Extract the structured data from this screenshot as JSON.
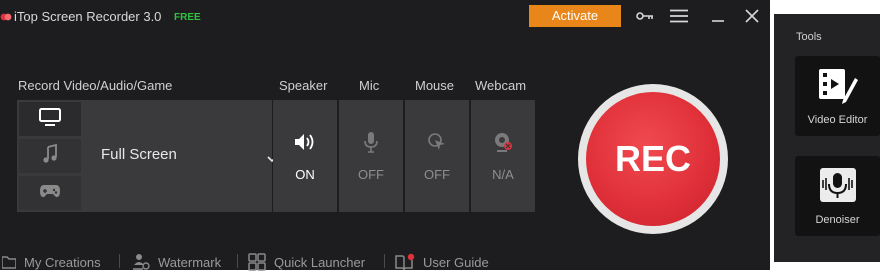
{
  "app": {
    "title": "iTop Screen Recorder 3.0",
    "badge": "FREE",
    "activate_label": "Activate"
  },
  "record": {
    "section_label": "Record Video/Audio/Game",
    "modes": [
      {
        "name": "screen",
        "icon": "monitor-icon"
      },
      {
        "name": "audio",
        "icon": "music-note-icon"
      },
      {
        "name": "game",
        "icon": "gamepad-icon"
      }
    ],
    "selected_area": "Full Screen"
  },
  "devices": [
    {
      "label": "Speaker",
      "state": "ON",
      "icon": "speaker-icon"
    },
    {
      "label": "Mic",
      "state": "OFF",
      "icon": "microphone-icon"
    },
    {
      "label": "Mouse",
      "state": "OFF",
      "icon": "mouse-click-icon"
    },
    {
      "label": "Webcam",
      "state": "N/A",
      "icon": "webcam-icon"
    }
  ],
  "rec_label": "REC",
  "bottom_bar": [
    {
      "label": "My Creations",
      "icon": "folder-icon"
    },
    {
      "label": "Watermark",
      "icon": "watermark-icon"
    },
    {
      "label": "Quick Launcher",
      "icon": "grid-icon"
    },
    {
      "label": "User Guide",
      "icon": "book-icon"
    }
  ],
  "tools": {
    "title": "Tools",
    "items": [
      {
        "label": "Video Editor",
        "icon": "video-editor-icon"
      },
      {
        "label": "Denoiser",
        "icon": "denoiser-icon"
      }
    ]
  },
  "colors": {
    "background": "#1d1d1f",
    "panel": "#3a3a3d",
    "accent_orange": "#e98619",
    "rec_red": "#e0313a",
    "free_green": "#2fc23f"
  }
}
